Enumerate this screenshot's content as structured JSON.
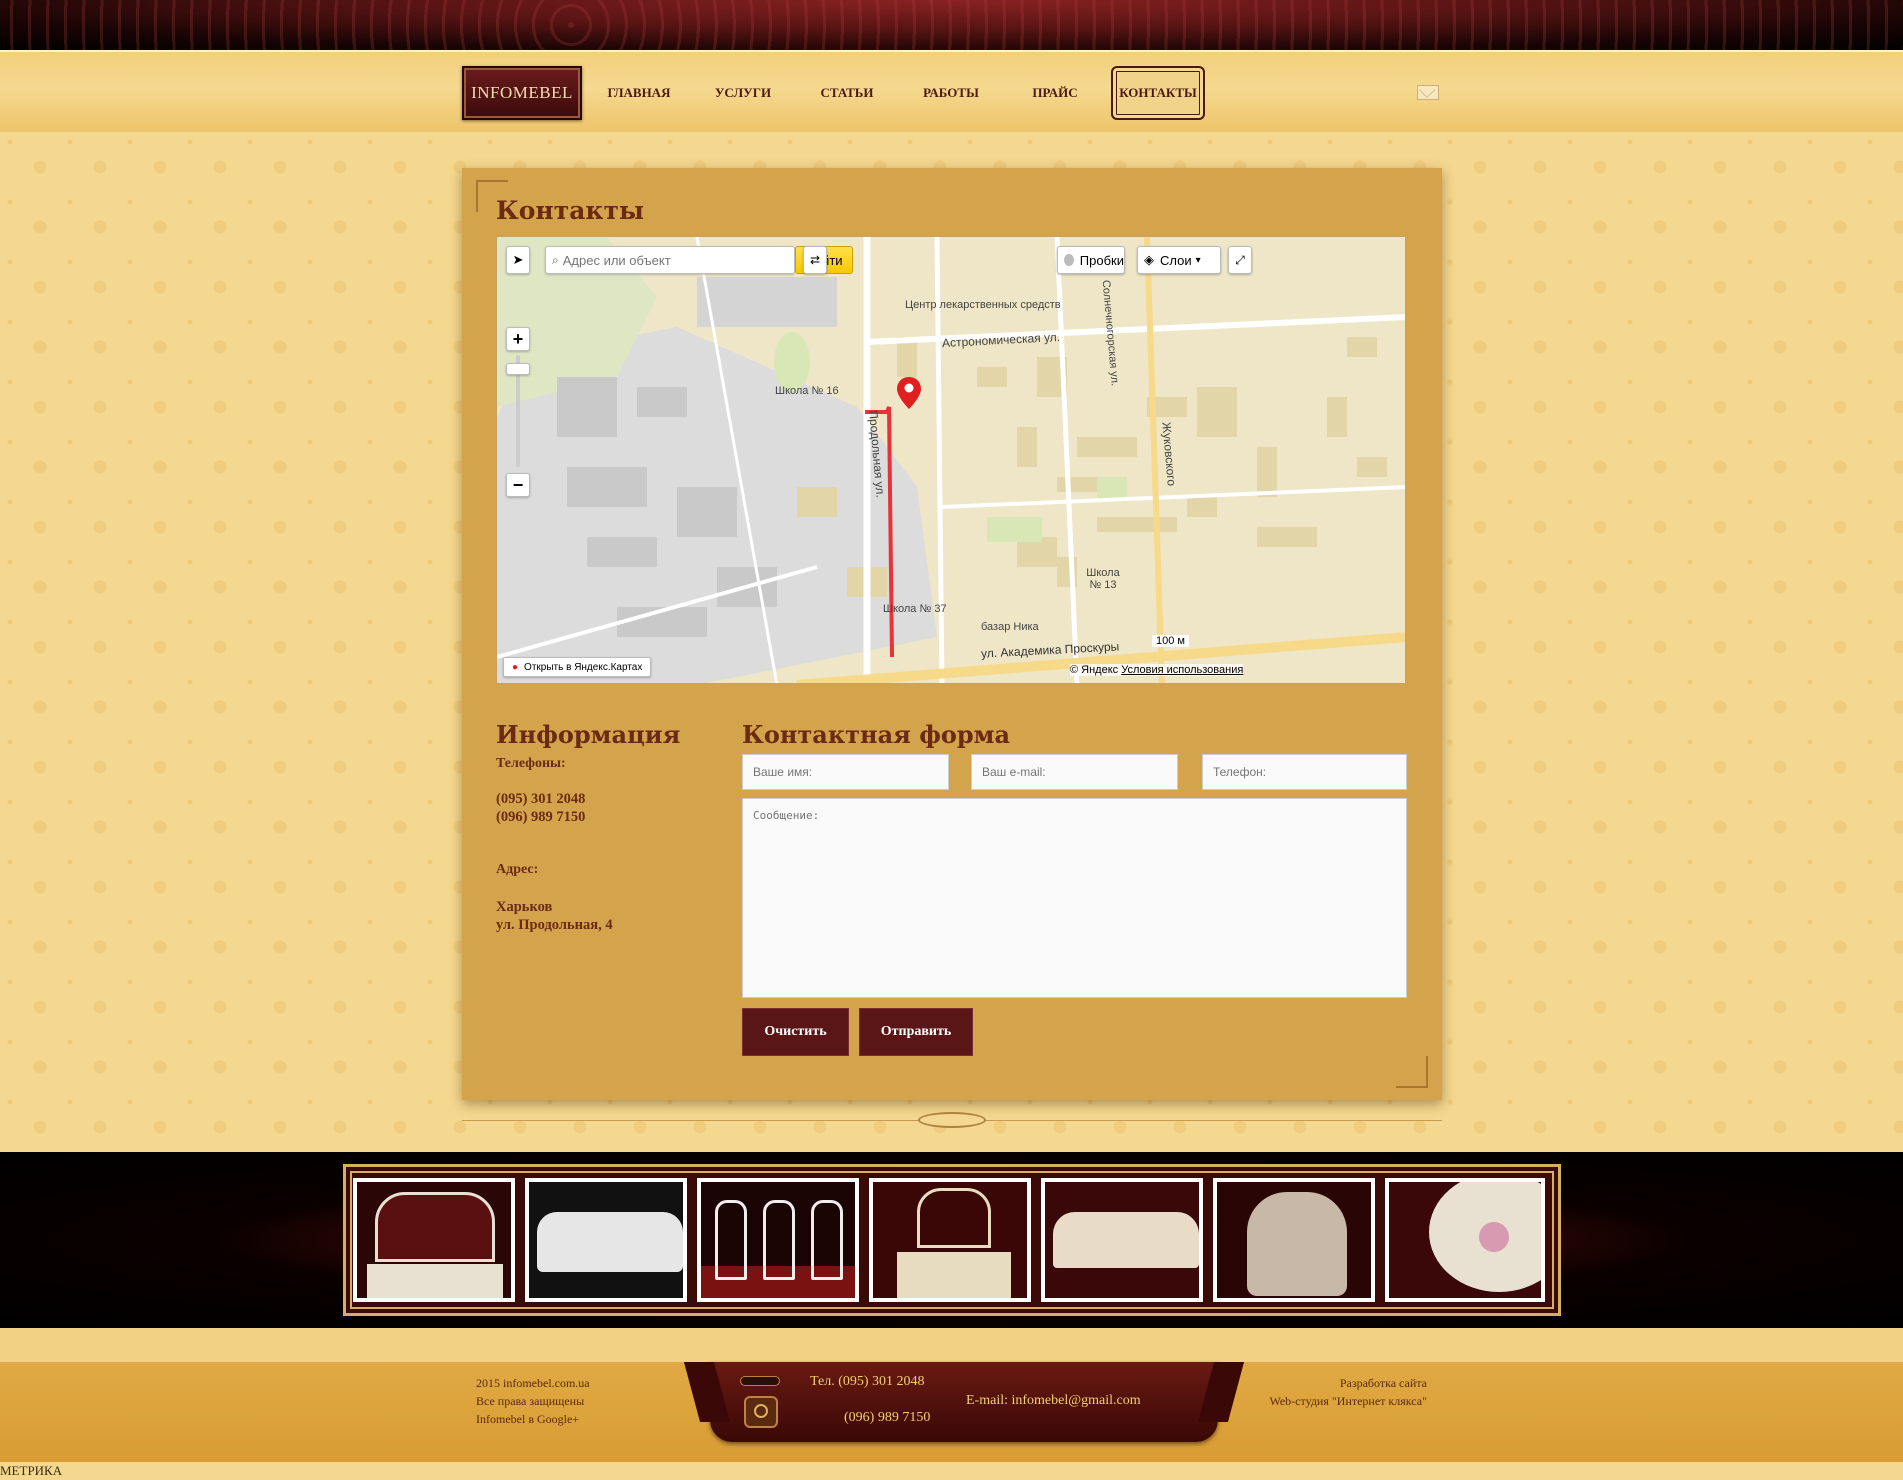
{
  "nav": {
    "logo": "INFOMEBEL",
    "items": [
      "ГЛАВНАЯ",
      "УСЛУГИ",
      "СТАТЬИ",
      "РАБОТЫ",
      "ПРАЙС",
      "КОНТАКТЫ"
    ],
    "active": "КОНТАКТЫ"
  },
  "page": {
    "title": "Контакты"
  },
  "map": {
    "search_placeholder": "Адрес или объект",
    "find_label": "Найти",
    "traffic_label": "Пробки",
    "layers_label": "Слои",
    "open_in_yandex": "Открыть в Яндекс.Картах",
    "copyright": "© Яндекс",
    "terms": "Условия использования",
    "scale": "100 м",
    "labels": {
      "pharmacy": "Центр лекарственных средств",
      "astronomicheskaya": "Астрономическая ул.",
      "school16": "Школа № 16",
      "school37": "Школа № 37",
      "school13": "Школа № 13",
      "bazar": "базар Ника",
      "prodolnaya": "Продольная ул.",
      "proskury": "ул. Академика Проскуры",
      "zhukovskogo": "Жуковского",
      "solnechnogorskaya": "Солнечногорская ул."
    }
  },
  "info": {
    "title": "Информация",
    "phones_label": "Телефоны:",
    "phone1": "(095) 301 2048",
    "phone2": "(096) 989 7150",
    "address_label": "Адрес:",
    "city": "Харьков",
    "street": "ул. Продольная, 4"
  },
  "form": {
    "title": "Контактная форма",
    "name_placeholder": "Ваше имя:",
    "email_placeholder": "Ваш e-mail:",
    "phone_placeholder": "Телефон:",
    "message_placeholder": "Сообщение:",
    "clear_label": "Очистить",
    "send_label": "Отправить"
  },
  "footer": {
    "copyright": "2015 infomebel.com.ua",
    "rights": "Все права защищены",
    "google": "Infomebel в Google+",
    "tel_label": "Тел. (095) 301 2048",
    "tel2": "(096) 989 7150",
    "email": "E-mail: infomebel@gmail.com",
    "dev_label": "Разработка сайта",
    "dev_studio": "Web-студия \"Интернет клякса\"",
    "metrika": "МЕТРИКА"
  },
  "colors": {
    "accent": "#5a1616",
    "gold": "#d4a44c",
    "text": "#6a2a14"
  }
}
